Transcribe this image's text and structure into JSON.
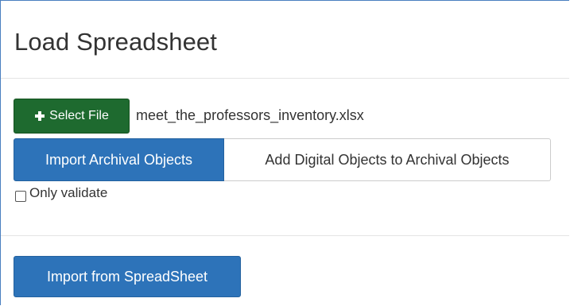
{
  "header": {
    "title": "Load Spreadsheet"
  },
  "file": {
    "select_label": "Select File",
    "select_icon": "plus-icon",
    "filename": "meet_the_professors_inventory.xlsx"
  },
  "tabs": [
    {
      "label": "Import Archival Objects",
      "active": true
    },
    {
      "label": "Add Digital Objects to Archival Objects",
      "active": false
    }
  ],
  "options": {
    "only_validate_label": "Only validate",
    "only_validate_checked": false
  },
  "footer": {
    "import_label": "Import from SpreadSheet"
  },
  "colors": {
    "select_button": "#1e6a2f",
    "primary": "#2d73b9",
    "border": "#cccccc"
  }
}
